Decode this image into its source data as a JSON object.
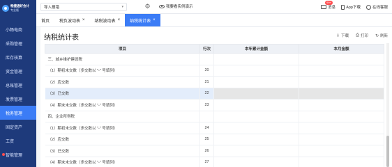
{
  "brand": {
    "name": "畅捷通好会计",
    "sub": "专业版"
  },
  "sidebar": {
    "items": [
      {
        "label": "小畅电商"
      },
      {
        "label": "采购管理"
      },
      {
        "label": "库存核算"
      },
      {
        "label": "资金管理"
      },
      {
        "label": "总账管理"
      },
      {
        "label": "发票管理"
      },
      {
        "label": "税务管理",
        "active": true
      },
      {
        "label": "固定资产"
      },
      {
        "label": "工资"
      },
      {
        "label": "智能管理"
      }
    ]
  },
  "topbar": {
    "company": "导入报错",
    "demo": "我要看实例演示",
    "message": "消息",
    "message_badge": "99+",
    "app_download": "App下载",
    "customer_service": "在线客服"
  },
  "tabs": [
    {
      "label": "首页"
    },
    {
      "label": "税负波动表"
    },
    {
      "label": "纳税波动表"
    },
    {
      "label": "纳税统计表"
    }
  ],
  "page": {
    "title": "纳税统计表",
    "download": "下载",
    "print": "打印",
    "refresh": "刷新"
  },
  "table": {
    "headers": [
      "项目",
      "行次",
      "本年累计金额",
      "本月金额"
    ],
    "rows": [
      {
        "item": "三、城乡维护建设税",
        "line": ""
      },
      {
        "item": "（1）期初未交数（多交数以 \"-\" 号填列）",
        "line": "20"
      },
      {
        "item": "（2）应交数",
        "line": "21"
      },
      {
        "item": "（3）已交数",
        "line": "22"
      },
      {
        "item": "（4）期末未交数（多交数以 \"-\" 号填列）",
        "line": "23"
      },
      {
        "item": "四、企业所得税",
        "line": ""
      },
      {
        "item": "（1）期初未交数（多交数以 \"-\" 号填列）",
        "line": "24"
      },
      {
        "item": "（2）应交数",
        "line": "25"
      },
      {
        "item": "（3）已交数",
        "line": "26"
      },
      {
        "item": "（4）期末未交数（多交数以 \"-\" 号填列）",
        "line": "27"
      }
    ]
  }
}
